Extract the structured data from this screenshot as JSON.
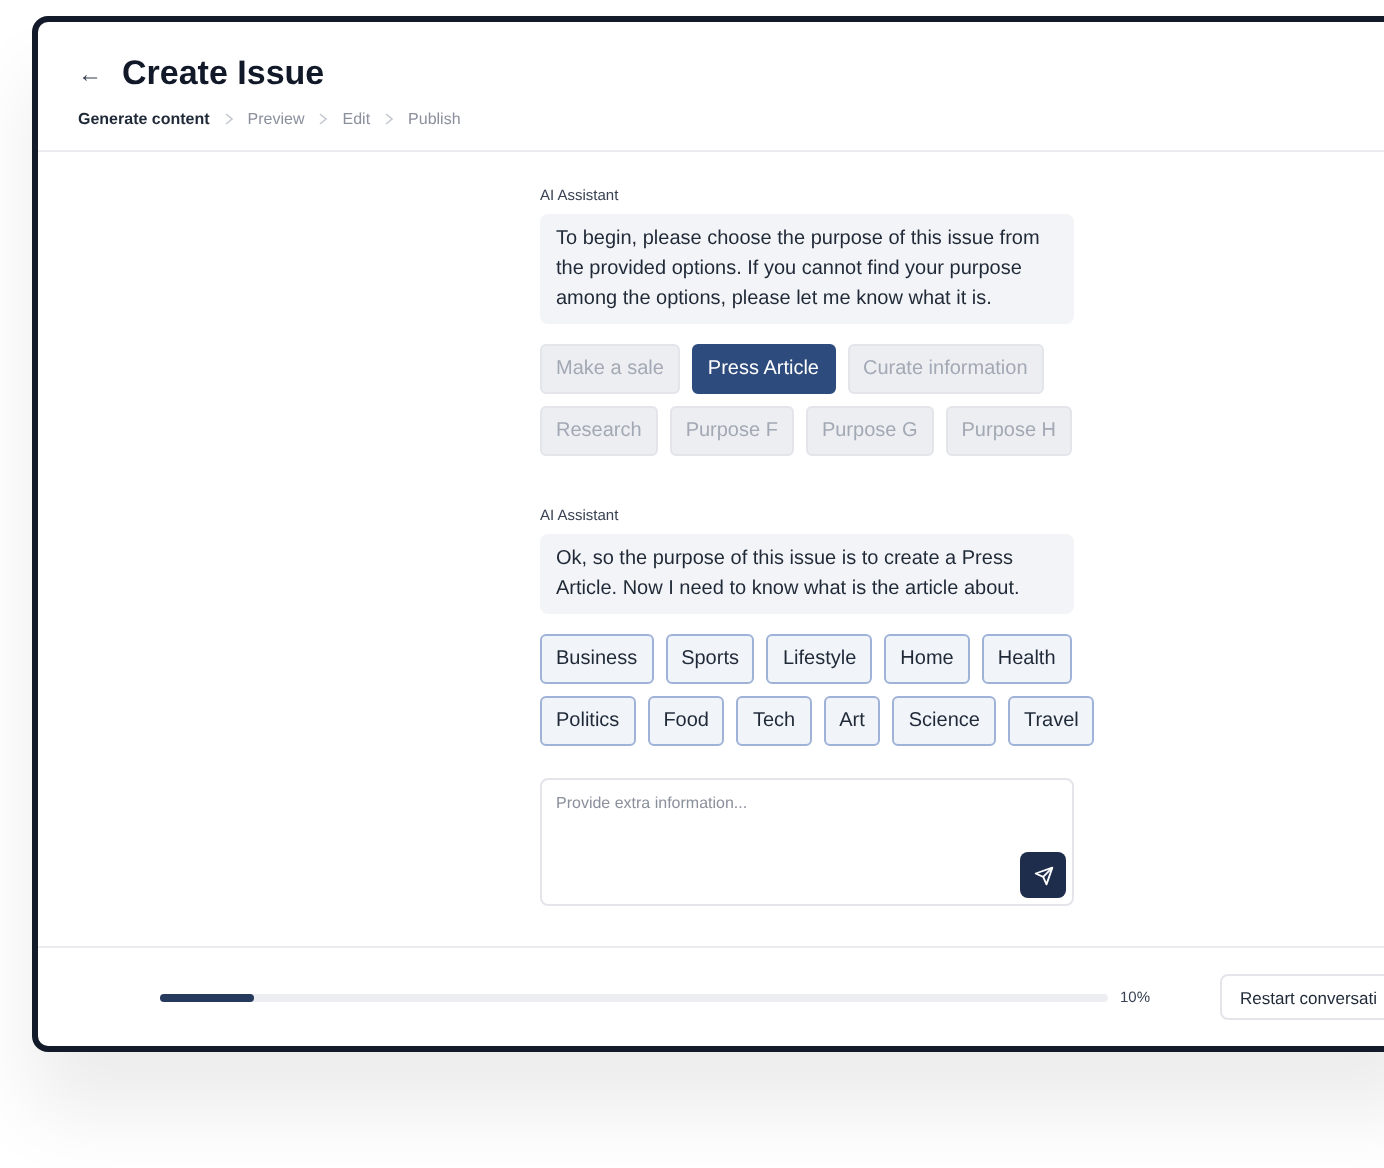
{
  "header": {
    "back_icon": "←",
    "title": "Create Issue"
  },
  "breadcrumbs": [
    {
      "label": "Generate content",
      "selected": true
    },
    {
      "label": "Preview",
      "selected": false
    },
    {
      "label": "Edit",
      "selected": false
    },
    {
      "label": "Publish",
      "selected": false
    }
  ],
  "messages": [
    {
      "sender": "AI Assistant",
      "text": "To begin, please choose the purpose of this issue from the provided options. If you cannot find your purpose among the options, please let me know what it is.",
      "options": [
        {
          "label": "Make a sale",
          "selected": false,
          "disabled": true
        },
        {
          "label": "Press Article",
          "selected": true,
          "disabled": false
        },
        {
          "label": "Curate information",
          "selected": false,
          "disabled": true
        },
        {
          "label": "Research",
          "selected": false,
          "disabled": true
        },
        {
          "label": "Purpose F",
          "selected": false,
          "disabled": true
        },
        {
          "label": "Purpose G",
          "selected": false,
          "disabled": true
        },
        {
          "label": "Purpose H",
          "selected": false,
          "disabled": true
        }
      ]
    },
    {
      "sender": "AI Assistant",
      "text": "Ok, so the purpose of this issue is to create a Press Article. Now I need to know what is the article about.",
      "options": [
        {
          "label": "Business",
          "selected": false,
          "disabled": false
        },
        {
          "label": "Sports",
          "selected": false,
          "disabled": false
        },
        {
          "label": "Lifestyle",
          "selected": false,
          "disabled": false
        },
        {
          "label": "Home",
          "selected": false,
          "disabled": false
        },
        {
          "label": "Health",
          "selected": false,
          "disabled": false
        },
        {
          "label": "Politics",
          "selected": false,
          "disabled": false
        },
        {
          "label": "Food",
          "selected": false,
          "disabled": false
        },
        {
          "label": "Tech",
          "selected": false,
          "disabled": false
        },
        {
          "label": "Art",
          "selected": false,
          "disabled": false
        },
        {
          "label": "Science",
          "selected": false,
          "disabled": false
        },
        {
          "label": "Travel",
          "selected": false,
          "disabled": false
        }
      ]
    }
  ],
  "composer": {
    "placeholder": "Provide extra information..."
  },
  "footer": {
    "progress": {
      "level": 0.1,
      "reading": "10%"
    },
    "restart_button": "Restart conversati"
  }
}
